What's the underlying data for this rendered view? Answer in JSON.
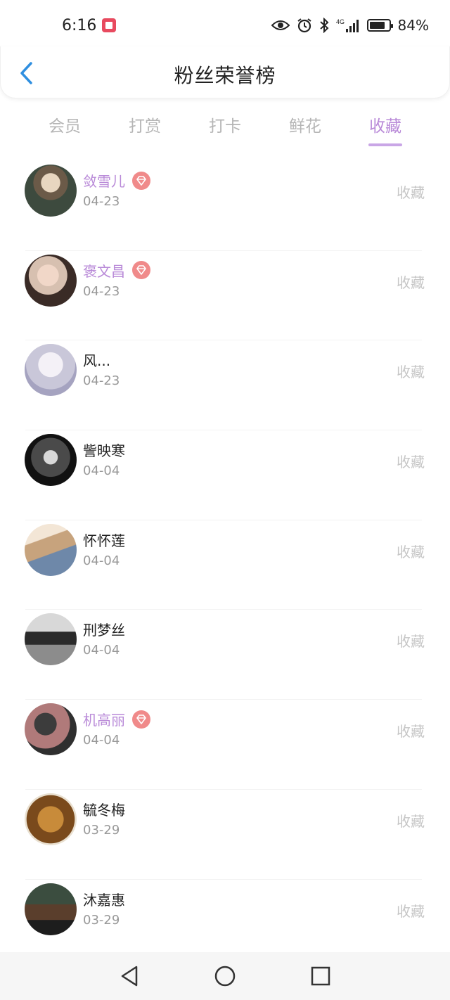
{
  "status_bar": {
    "time": "6:16",
    "network": "4G",
    "battery": "84%",
    "battery_level": 0.84
  },
  "header": {
    "title": "粉丝荣誉榜",
    "back_icon": "chevron-left-icon"
  },
  "tabs": [
    {
      "label": "会员",
      "active": false
    },
    {
      "label": "打赏",
      "active": false
    },
    {
      "label": "打卡",
      "active": false
    },
    {
      "label": "鲜花",
      "active": false
    },
    {
      "label": "收藏",
      "active": true
    }
  ],
  "rows": [
    {
      "name": "敛雪儿",
      "date": "04-23",
      "vip": true,
      "action": "收藏"
    },
    {
      "name": "褒文昌",
      "date": "04-23",
      "vip": true,
      "action": "收藏"
    },
    {
      "name": "风...",
      "date": "04-23",
      "vip": false,
      "action": "收藏"
    },
    {
      "name": "訾映寒",
      "date": "04-04",
      "vip": false,
      "action": "收藏"
    },
    {
      "name": "怀怀莲",
      "date": "04-04",
      "vip": false,
      "action": "收藏"
    },
    {
      "name": "刑梦丝",
      "date": "04-04",
      "vip": false,
      "action": "收藏"
    },
    {
      "name": "机高丽",
      "date": "04-04",
      "vip": true,
      "action": "收藏"
    },
    {
      "name": "毓冬梅",
      "date": "03-29",
      "vip": false,
      "action": "收藏"
    },
    {
      "name": "沐嘉惠",
      "date": "03-29",
      "vip": false,
      "action": "收藏"
    }
  ],
  "colors": {
    "accent": "#b98ad8",
    "vip_badge": "#f08a8a",
    "back_arrow": "#2f8fe0"
  }
}
